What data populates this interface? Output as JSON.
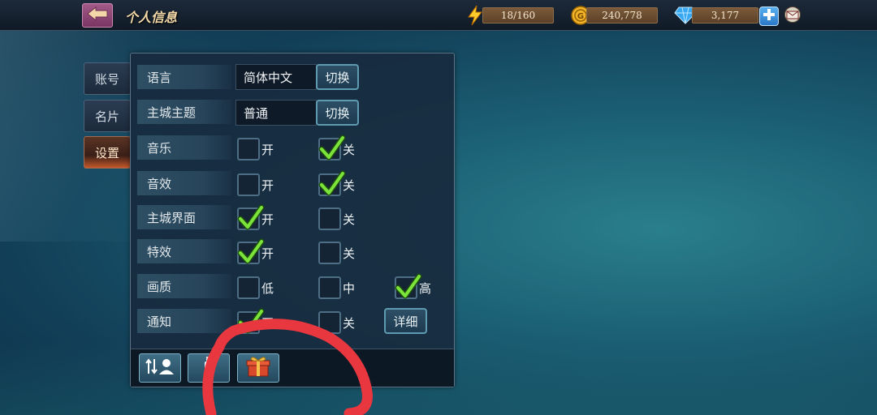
{
  "header": {
    "title": "个人信息",
    "energy": "18/160",
    "gold": "240,778",
    "gems": "3,177"
  },
  "tabs": [
    {
      "label": "账号",
      "active": false
    },
    {
      "label": "名片",
      "active": false
    },
    {
      "label": "设置",
      "active": true
    }
  ],
  "settings": {
    "language": {
      "label": "语言",
      "value": "简体中文",
      "button": "切换"
    },
    "theme": {
      "label": "主城主题",
      "value": "普通",
      "button": "切换"
    },
    "music": {
      "label": "音乐",
      "on": "开",
      "off": "关",
      "on_checked": false,
      "off_checked": true
    },
    "sfx": {
      "label": "音效",
      "on": "开",
      "off": "关",
      "on_checked": false,
      "off_checked": true
    },
    "city_ui": {
      "label": "主城界面",
      "on": "开",
      "off": "关",
      "on_checked": true,
      "off_checked": false
    },
    "effects": {
      "label": "特效",
      "on": "开",
      "off": "关",
      "on_checked": true,
      "off_checked": false
    },
    "quality": {
      "label": "画质",
      "low": "低",
      "mid": "中",
      "high": "高",
      "selected": "高"
    },
    "notify": {
      "label": "通知",
      "on": "开",
      "off": "关",
      "detail": "详细",
      "on_checked": true,
      "off_checked": false
    }
  },
  "colors": {
    "accent_check": "#7be33a",
    "scribble": "#e8373f",
    "panel_bg": "#182a3e"
  },
  "icons": [
    "back-arrow-icon",
    "lightning-icon",
    "gold-coin-icon",
    "diamond-icon",
    "plus-icon",
    "mail-icon",
    "sort-user-icon",
    "bottle-icon",
    "gift-icon"
  ]
}
